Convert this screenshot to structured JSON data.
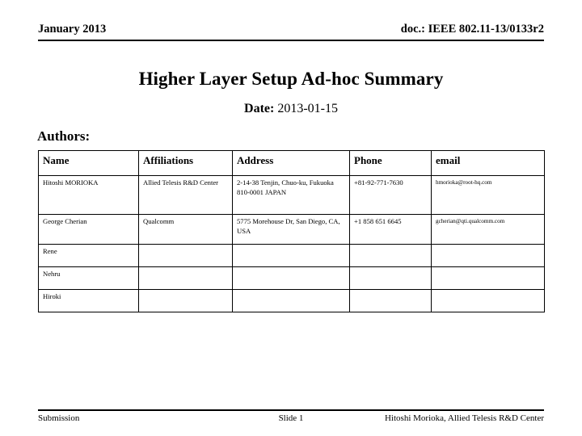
{
  "header": {
    "left": "January 2013",
    "right": "doc.: IEEE 802.11-13/0133r2"
  },
  "title": "Higher Layer Setup Ad-hoc Summary",
  "date": {
    "label": "Date:",
    "value": "2013-01-15"
  },
  "authors_section": {
    "label": "Authors:",
    "columns": [
      "Name",
      "Affiliations",
      "Address",
      "Phone",
      "email"
    ],
    "rows": [
      {
        "name": "Hitoshi MORIOKA",
        "affiliation": "Allied Telesis R&D Center",
        "address": "2-14-38 Tenjin, Chuo-ku, Fukuoka 810-0001 JAPAN",
        "phone": "+81-92-771-7630",
        "email": "hmorioka@root-hq.com"
      },
      {
        "name": "George Cherian",
        "affiliation": "Qualcomm",
        "address": "5775 Morehouse Dr, San Diego, CA, USA",
        "phone": "+1 858 651 6645",
        "email": "gcherian@qti.qualcomm.com"
      },
      {
        "name": "Rene",
        "affiliation": "",
        "address": "",
        "phone": "",
        "email": ""
      },
      {
        "name": "Nehru",
        "affiliation": "",
        "address": "",
        "phone": "",
        "email": ""
      },
      {
        "name": "Hiroki",
        "affiliation": "",
        "address": "",
        "phone": "",
        "email": ""
      }
    ]
  },
  "footer": {
    "left": "Submission",
    "center": "Slide 1",
    "right": "Hitoshi Morioka, Allied Telesis R&D Center"
  }
}
